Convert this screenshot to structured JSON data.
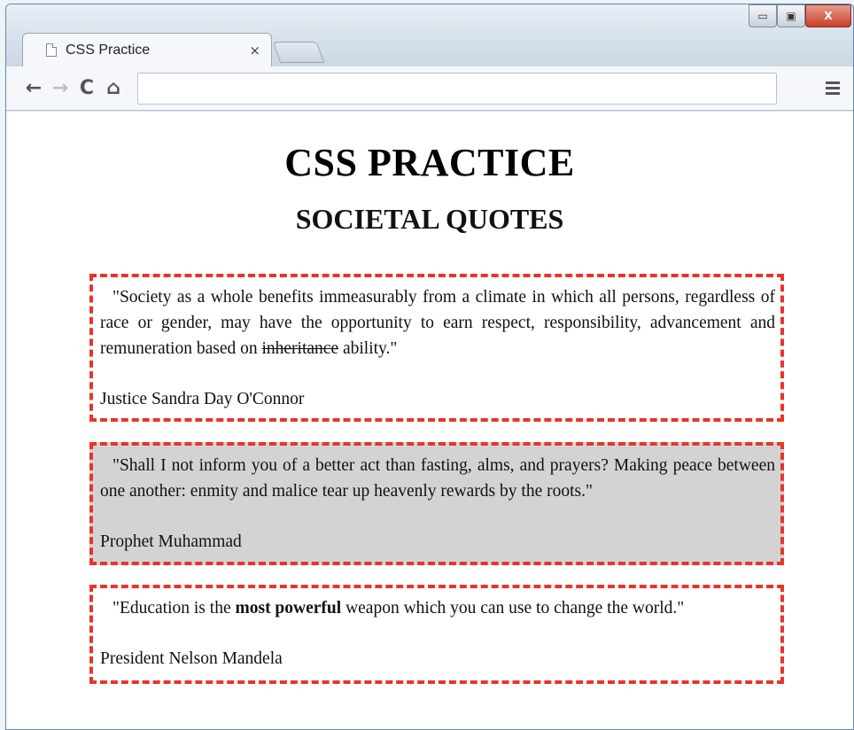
{
  "browser": {
    "tab_title": "CSS Practice",
    "tab_close": "×",
    "address_bar_value": "",
    "window_controls": {
      "minimize": "▭",
      "maximize": "▣",
      "close": "X"
    },
    "nav": {
      "back": "←",
      "forward": "→",
      "reload": "C",
      "home": "⌂"
    }
  },
  "page": {
    "title": "CSS PRACTICE",
    "section_title": "SOCIETAL QUOTES",
    "quotes": [
      {
        "text_before": "\"Society as a whole benefits immeasurably from a climate in which all persons, regardless of race or gender, may have the opportunity to earn respect, responsibility, advancement and remuneration based on ",
        "text_struck": "inheritance",
        "text_after": " ability.\"",
        "author": "Justice Sandra Day O'Connor"
      },
      {
        "text": "\"Shall I not inform you of a better act than fasting, alms, and prayers? Making peace between one another: enmity and malice tear up heavenly rewards by the roots.\"",
        "author": "Prophet Muhammad"
      },
      {
        "text_before": "\"Education is the ",
        "text_bold": "most powerful",
        "text_after": " weapon which you can use to change the world.\"",
        "author": "President Nelson Mandela"
      }
    ]
  },
  "colors": {
    "border_dashed": "#e8342c",
    "shaded_background": "#d3d3d3"
  }
}
